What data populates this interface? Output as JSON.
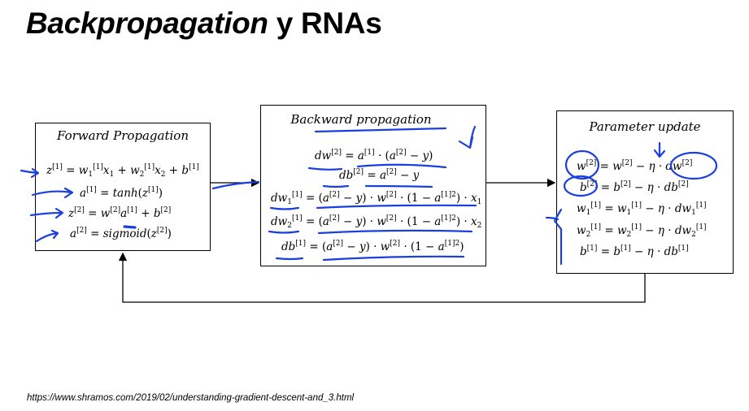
{
  "title": {
    "part1": "Backpropagation",
    "part2": " y RNAs"
  },
  "forward": {
    "header": "Forward Propagation",
    "equations": [
      "z[1] = w1[1]x1 + w2[1]x2 + b[1]",
      "a[1] = tanh(z[1])",
      "z[2] = w[2]a[1] + b[2]",
      "a[2] = sigmoid(z[2])"
    ]
  },
  "backward": {
    "header": "Backward propagation",
    "equations": [
      "dw[2] = a[1] · (a[2] − y)",
      "db[2] = a[2] − y",
      "dw1[1] = (a[2] − y) · w[2] · (1 − a[1]^2) · x1",
      "dw2[1] = (a[2] − y) · w[2] · (1 − a[1]^2) · x2",
      "db[1] = (a[2] − y) · w[2] · (1 − a[1]^2)"
    ]
  },
  "update": {
    "header": "Parameter update",
    "equations": [
      "w[2] = w[2] − η · dw[2]",
      "b[2] = b[2] − η · db[2]",
      "w1[1] = w1[1] − η · dw1[1]",
      "w2[1] = w2[1] − η · dw2[1]",
      "b[1] = b[1] − η · db[1]"
    ]
  },
  "source": "https://www.shramos.com/2019/02/understanding-gradient-descent-and_3.html",
  "colors": {
    "ink": "#1a3fe0",
    "line": "#000000"
  }
}
